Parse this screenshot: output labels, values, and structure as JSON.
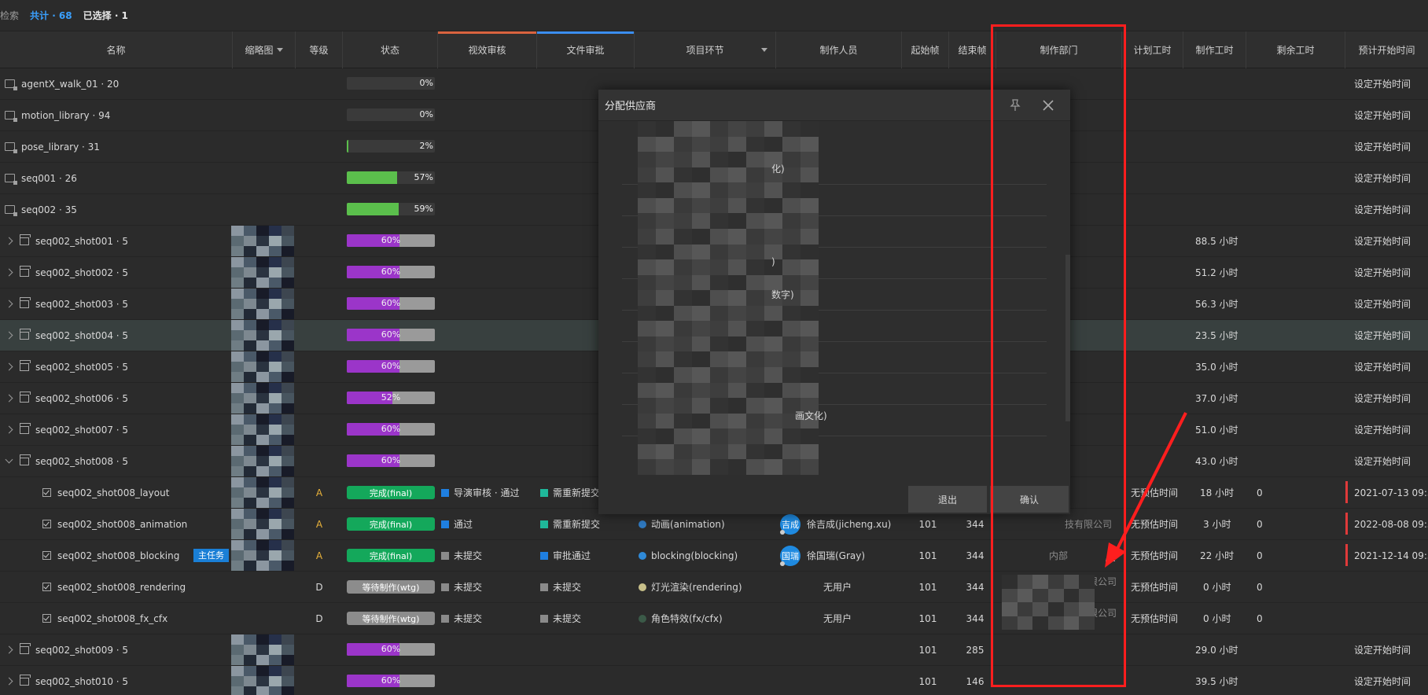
{
  "topbar": {
    "search_label": "检索",
    "total": "共计 · 68",
    "selected": "已选择 · 1"
  },
  "columns": {
    "name": "名称",
    "thumb": "缩略图",
    "grade": "等级",
    "status": "状态",
    "visual_review": "视效审核",
    "file_review": "文件审批",
    "step": "项目环节",
    "artist": "制作人员",
    "start_frame": "起始帧",
    "end_frame": "结束帧",
    "department": "制作部门",
    "plan_time": "计划工时",
    "work_time": "制作工时",
    "remain_time": "剩余工时",
    "plan_start": "预计开始时间"
  },
  "colors": {
    "visual_review_accent": "#d9633f",
    "file_review_accent": "#3b8ef0",
    "highlight_box": "#ff1e1e"
  },
  "rows": [
    {
      "name": "agentX_walk_01 · 20",
      "progress": "0%",
      "progress_value": 0,
      "plan_start": "设定开始时间"
    },
    {
      "name": "motion_library · 94",
      "progress": "0%",
      "progress_value": 0,
      "plan_start": "设定开始时间"
    },
    {
      "name": "pose_library · 31",
      "progress": "2%",
      "progress_value": 2,
      "plan_start": "设定开始时间"
    },
    {
      "name": "seq001 · 26",
      "progress": "57%",
      "progress_value": 57,
      "plan_start": "设定开始时间"
    },
    {
      "name": "seq002 · 35",
      "progress": "59%",
      "progress_value": 59,
      "plan_start": "设定开始时间"
    },
    {
      "name": "seq002_shot001 · 5",
      "progress": "60%",
      "progress_value": 60,
      "work_time": "88.5 小时",
      "plan_start": "设定开始时间"
    },
    {
      "name": "seq002_shot002 · 5",
      "progress": "60%",
      "progress_value": 60,
      "work_time": "51.2 小时",
      "plan_start": "设定开始时间"
    },
    {
      "name": "seq002_shot003 · 5",
      "progress": "60%",
      "progress_value": 60,
      "work_time": "56.3 小时",
      "plan_start": "设定开始时间"
    },
    {
      "name": "seq002_shot004 · 5",
      "progress": "60%",
      "progress_value": 60,
      "work_time": "23.5 小时",
      "plan_start": "设定开始时间"
    },
    {
      "name": "seq002_shot005 · 5",
      "progress": "60%",
      "progress_value": 60,
      "work_time": "35.0 小时",
      "plan_start": "设定开始时间"
    },
    {
      "name": "seq002_shot006 · 5",
      "progress": "52%",
      "progress_value": 52,
      "work_time": "37.0 小时",
      "plan_start": "设定开始时间"
    },
    {
      "name": "seq002_shot007 · 5",
      "progress": "60%",
      "progress_value": 60,
      "work_time": "51.0 小时",
      "plan_start": "设定开始时间"
    },
    {
      "name": "seq002_shot008 · 5",
      "progress": "60%",
      "progress_value": 60,
      "work_time": "43.0 小时",
      "plan_start": "设定开始时间"
    },
    {
      "name": "seq002_shot008_layout",
      "grade": "A",
      "status": "完成(final)",
      "visual": "导演审核 · 通过",
      "file": "需重新提交",
      "plan_time": "无预估时间",
      "work_time": "18 小时",
      "remain_time": "0",
      "plan_start": "2021-07-13 09:30"
    },
    {
      "name": "seq002_shot008_animation",
      "grade": "A",
      "status": "完成(final)",
      "visual": "通过",
      "file": "需重新提交",
      "step": "动画(animation)",
      "avatar": "吉成",
      "artist": "徐吉成(jicheng.xu)",
      "start_frame": "101",
      "end_frame": "344",
      "plan_time": "无预估时间",
      "work_time": "3 小时",
      "remain_time": "0",
      "plan_start": "2022-08-08 09:30"
    },
    {
      "name": "seq002_shot008_blocking",
      "tag": "主任务",
      "grade": "A",
      "status": "完成(final)",
      "visual": "未提交",
      "file": "审批通过",
      "step": "blocking(blocking)",
      "avatar": "国瑞",
      "artist": "徐国瑞(Gray)",
      "start_frame": "101",
      "end_frame": "344",
      "department": "内部",
      "plan_time": "无预估时间",
      "work_time": "22 小时",
      "remain_time": "0",
      "plan_start": "2021-12-14 09:30"
    },
    {
      "name": "seq002_shot008_rendering",
      "grade": "D",
      "status": "等待制作(wtg)",
      "visual": "未提交",
      "file": "未提交",
      "step": "灯光渲染(rendering)",
      "artist": "无用户",
      "start_frame": "101",
      "end_frame": "344",
      "dept_suffix": "限公司",
      "plan_time": "无预估时间",
      "work_time": "0 小时",
      "remain_time": "0"
    },
    {
      "name": "seq002_shot008_fx_cfx",
      "grade": "D",
      "status": "等待制作(wtg)",
      "visual": "未提交",
      "file": "未提交",
      "step": "角色特效(fx/cfx)",
      "artist": "无用户",
      "start_frame": "101",
      "end_frame": "344",
      "dept_suffix": "限公司",
      "plan_time": "无预估时间",
      "work_time": "0 小时",
      "remain_time": "0"
    },
    {
      "name": "seq002_shot009 · 5",
      "progress": "60%",
      "progress_value": 60,
      "start_frame": "101",
      "end_frame": "285",
      "work_time": "29.0 小时",
      "plan_start": "设定开始时间"
    },
    {
      "name": "seq002_shot010 · 5",
      "progress": "60%",
      "progress_value": 60,
      "start_frame": "101",
      "end_frame": "146",
      "work_time": "39.5 小时",
      "plan_start": "设定开始时间"
    }
  ],
  "row_extra": {
    "animation_dept_suffix": "技有限公司"
  },
  "dialog": {
    "title": "分配供应商",
    "items": [
      "化)",
      ")",
      "数字)",
      "画文化)"
    ],
    "cancel": "退出",
    "confirm": "确认",
    "pin_icon": "pin-icon",
    "close_icon": "close-icon"
  }
}
